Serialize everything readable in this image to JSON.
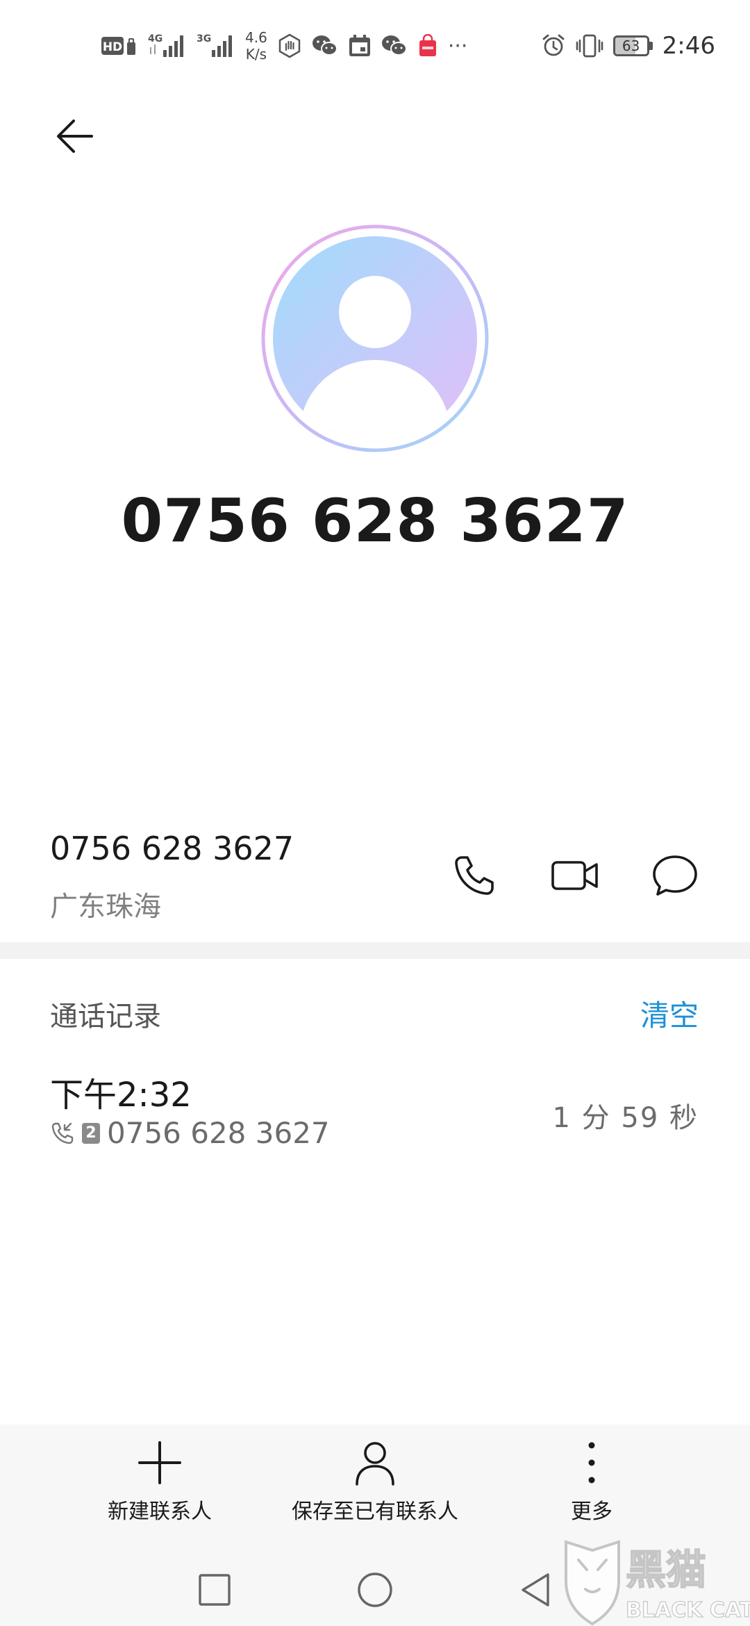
{
  "status_bar": {
    "hd_badge": "HD",
    "signal_1_type": "4G",
    "signal_2_type": "3G",
    "net_speed_value": "4.6",
    "net_speed_unit": "K/s",
    "more_dots": "···",
    "battery_level": 63,
    "battery_text": "63",
    "time": "2:46",
    "icons": [
      "hd-icon",
      "signal-4g-icon",
      "signal-3g-icon",
      "hand-icon",
      "wechat-icon",
      "calendar-icon",
      "wechat-icon",
      "shopping-bag-icon",
      "alarm-icon",
      "vibrate-icon",
      "battery-icon"
    ]
  },
  "contact": {
    "display_number": "0756 628 3627",
    "number": "0756 628 3627",
    "location": "广东珠海"
  },
  "call_log": {
    "title": "通话记录",
    "clear_label": "清空",
    "entries": [
      {
        "time": "下午2:32",
        "sim": "2",
        "number": "0756 628 3627",
        "duration": "1 分 59 秒"
      }
    ]
  },
  "toolbar": {
    "new_contact_label": "新建联系人",
    "save_existing_label": "保存至已有联系人",
    "more_label": "更多"
  },
  "watermark": {
    "cn_text": "黑猫",
    "en_text": "BLACK CAT"
  },
  "colors": {
    "accent": "#1e90d6",
    "avatar_gradient_start": "#a5dcfc",
    "avatar_gradient_end": "#dcc0f8",
    "secondary_text": "#808080"
  }
}
